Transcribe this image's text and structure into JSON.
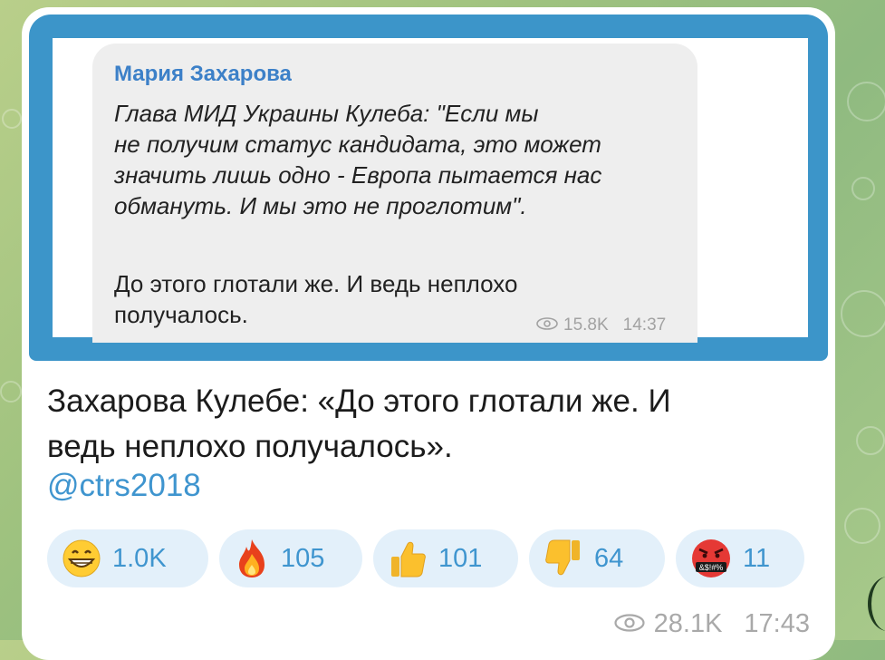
{
  "quoted_post": {
    "author": "Мария Захарова",
    "lines_italic": [
      "Глава МИД Украины Кулеба: \"Если мы",
      "не получим статус кандидата, это может",
      "значить лишь одно - Европа пытается нас",
      "обмануть. И мы это не проглотим\"."
    ],
    "lines_regular": [
      "До этого глотали же. И ведь неплохо",
      "получалось."
    ],
    "views": "15.8K",
    "time": "14:37"
  },
  "caption": {
    "line1": "Захарова Кулебе: «До этого глотали же. И",
    "line2": "ведь неплохо получалось».",
    "channel_link": "@ctrs2018"
  },
  "reactions": [
    {
      "icon": "grinning-face-icon",
      "count": "1.0K"
    },
    {
      "icon": "fire-icon",
      "count": "105"
    },
    {
      "icon": "thumbs-up-icon",
      "count": "101"
    },
    {
      "icon": "thumbs-down-icon",
      "count": "64"
    },
    {
      "icon": "cursing-face-icon",
      "count": "11",
      "glyph_text": "&$!#%"
    }
  ],
  "message_meta": {
    "views": "28.1K",
    "time": "17:43"
  },
  "colors": {
    "link": "#3f95cf",
    "media_frame": "#3c95c9",
    "reaction_bg": "#e3f0fa",
    "author": "#3c80c8"
  }
}
